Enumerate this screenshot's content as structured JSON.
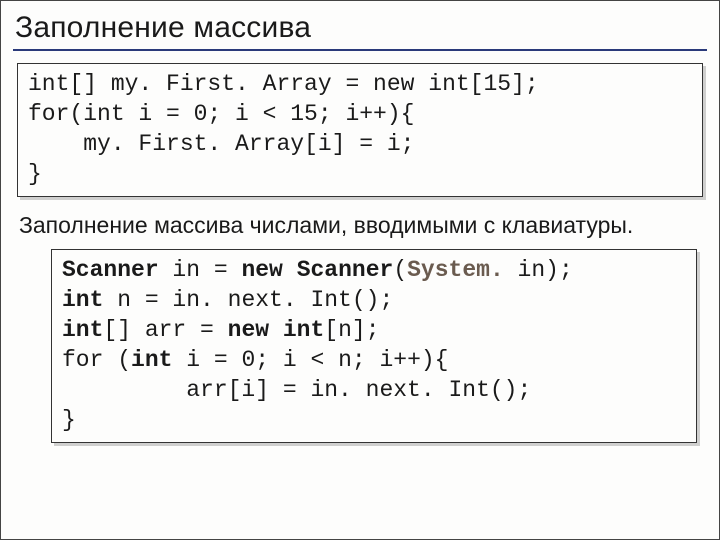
{
  "title": "Заполнение массива",
  "code1": {
    "line1": "int[] my. First. Array = new int[15];",
    "line2": "for(int i = 0; i < 15; i++){",
    "line3": "    my. First. Array[i] = i;",
    "line4": "}"
  },
  "paragraph": "Заполнение массива числами, вводимыми с клавиатуры.",
  "code2": {
    "line1_a": "Scanner",
    "line1_b": " in = ",
    "line1_c": "new",
    "line1_d": " ",
    "line1_e": "Scanner",
    "line1_f": "(",
    "line1_g": "System.",
    "line1_h": " in);",
    "line2_a": "int",
    "line2_b": " n = in. next. Int();",
    "line3_a": "int",
    "line3_b": "[] arr = ",
    "line3_c": "new int",
    "line3_d": "[n];",
    "line4_a": "for (",
    "line4_b": "int",
    "line4_c": " i = 0; i < n; i++){",
    "line5": "         arr[i] = in. next. Int();",
    "line6": "}"
  }
}
